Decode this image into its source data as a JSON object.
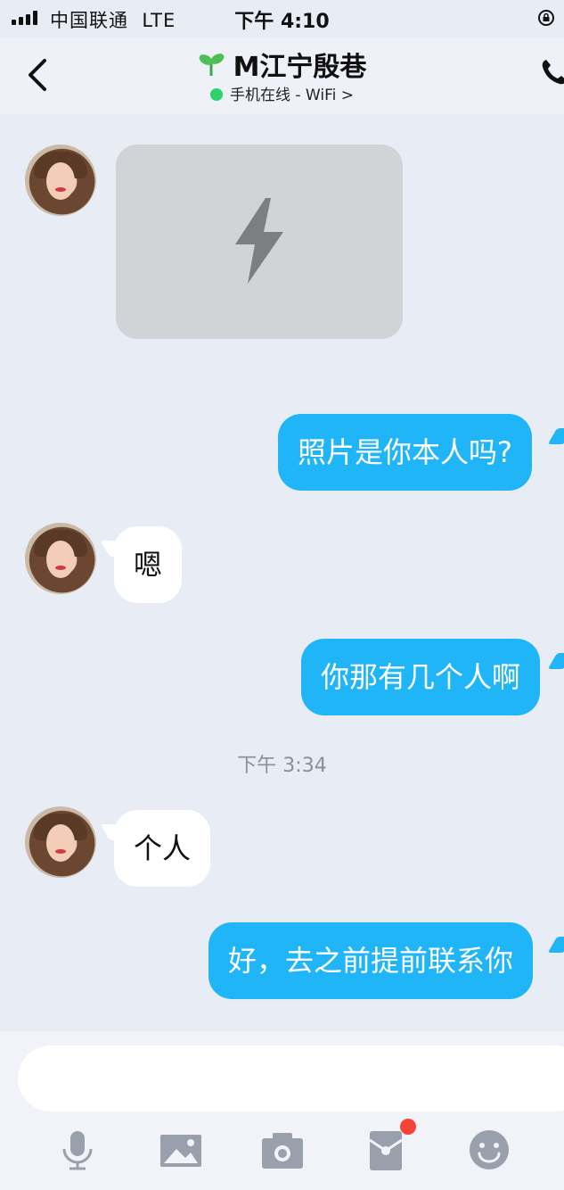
{
  "status_bar": {
    "carrier": "中国联通",
    "network": "LTE",
    "time": "下午 4:10"
  },
  "header": {
    "title": "M江宁殷巷",
    "status": "手机在线 - WiFi",
    "status_arrow": ">",
    "online_color": "#2ed16b"
  },
  "messages": [
    {
      "type": "image",
      "direction": "in"
    },
    {
      "type": "text",
      "direction": "out",
      "text": "照片是你本人吗?"
    },
    {
      "type": "text",
      "direction": "in",
      "text": "嗯"
    },
    {
      "type": "text",
      "direction": "out",
      "text": "你那有几个人啊"
    },
    {
      "type": "timestamp",
      "text": "下午 3:34"
    },
    {
      "type": "text",
      "direction": "in",
      "text": "个人"
    },
    {
      "type": "text",
      "direction": "out",
      "text": "好，去之前提前联系你"
    }
  ],
  "toolbar": {
    "icons": [
      "microphone-icon",
      "image-icon",
      "camera-icon",
      "red-packet-icon",
      "emoji-icon"
    ],
    "badge_color": "#f54336"
  },
  "colors": {
    "outgoing_bubble": "#1fb5f6",
    "incoming_bubble": "#ffffff",
    "background": "#e8ecf4"
  }
}
